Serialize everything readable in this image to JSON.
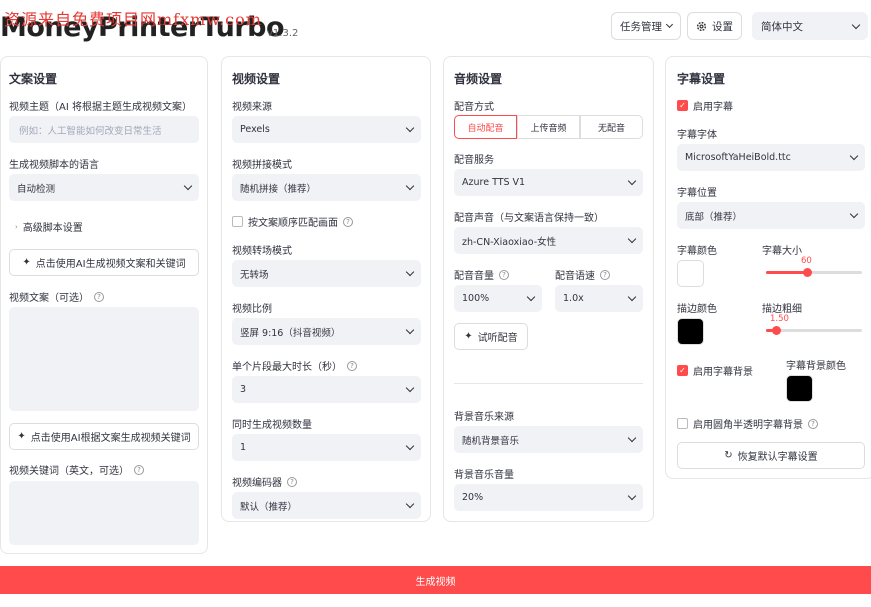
{
  "watermark": "资源来自免费项目网mfxmw.com",
  "app": {
    "title": "MoneyPrinterTurbo",
    "version": "v1.3.2"
  },
  "header": {
    "task_mgmt": "任务管理",
    "settings": "设置",
    "language": "简体中文"
  },
  "script_panel": {
    "title": "文案设置",
    "subject_label": "视频主题（AI 将根据主题生成视频文案）",
    "subject_placeholder": "例如：人工智能如何改变日常生活",
    "language_label": "生成视频脚本的语言",
    "language_value": "自动检测",
    "advanced": "高级脚本设置",
    "gen_script_btn": "点击使用AI生成视频文案和关键词",
    "script_label": "视频文案（可选）",
    "gen_keywords_btn": "点击使用AI根据文案生成视频关键词",
    "keywords_label": "视频关键词（英文，可选）"
  },
  "video_panel": {
    "title": "视频设置",
    "source_label": "视频来源",
    "source_value": "Pexels",
    "concat_label": "视频拼接模式",
    "concat_value": "随机拼接（推荐）",
    "match_label": "按文案顺序匹配画面",
    "transition_label": "视频转场模式",
    "transition_value": "无转场",
    "ratio_label": "视频比例",
    "ratio_value": "竖屏 9:16（抖音视频）",
    "clip_label": "单个片段最大时长（秒）",
    "clip_value": "3",
    "count_label": "同时生成视频数量",
    "count_value": "1",
    "codec_label": "视频编码器",
    "codec_value": "默认（推荐）"
  },
  "audio_panel": {
    "title": "音频设置",
    "mode_label": "配音方式",
    "modes": [
      "自动配音",
      "上传音频",
      "无配音"
    ],
    "service_label": "配音服务",
    "service_value": "Azure TTS V1",
    "voice_label": "配音声音（与文案语言保持一致）",
    "voice_value": "zh-CN-Xiaoxiao-女性",
    "volume_label": "配音音量",
    "volume_value": "100%",
    "speed_label": "配音语速",
    "speed_value": "1.0x",
    "test_btn": "试听配音",
    "bgm_source_label": "背景音乐来源",
    "bgm_source_value": "随机背景音乐",
    "bgm_volume_label": "背景音乐音量",
    "bgm_volume_value": "20%"
  },
  "subtitle_panel": {
    "title": "字幕设置",
    "enable_label": "启用字幕",
    "font_label": "字幕字体",
    "font_value": "MicrosoftYaHeiBold.ttc",
    "pos_label": "字幕位置",
    "pos_value": "底部（推荐）",
    "color_label": "字幕颜色",
    "color_value": "#ffffff",
    "size_label": "字幕大小",
    "size_value": "60",
    "size_fraction": 0.43,
    "stroke_color_label": "描边颜色",
    "stroke_color_value": "#000000",
    "stroke_width_label": "描边粗细",
    "stroke_width_value": "1.50",
    "stroke_fraction": 0.1,
    "bg_enable_label": "启用字幕背景",
    "bg_color_label": "字幕背景颜色",
    "bg_color_value": "#000000",
    "rounded_label": "启用圆角半透明字幕背景",
    "reset_btn": "恢复默认字幕设置"
  },
  "generate_btn": "生成视频",
  "colors": {
    "accent": "#ff4b4b",
    "field_bg": "#f0f2f6"
  }
}
